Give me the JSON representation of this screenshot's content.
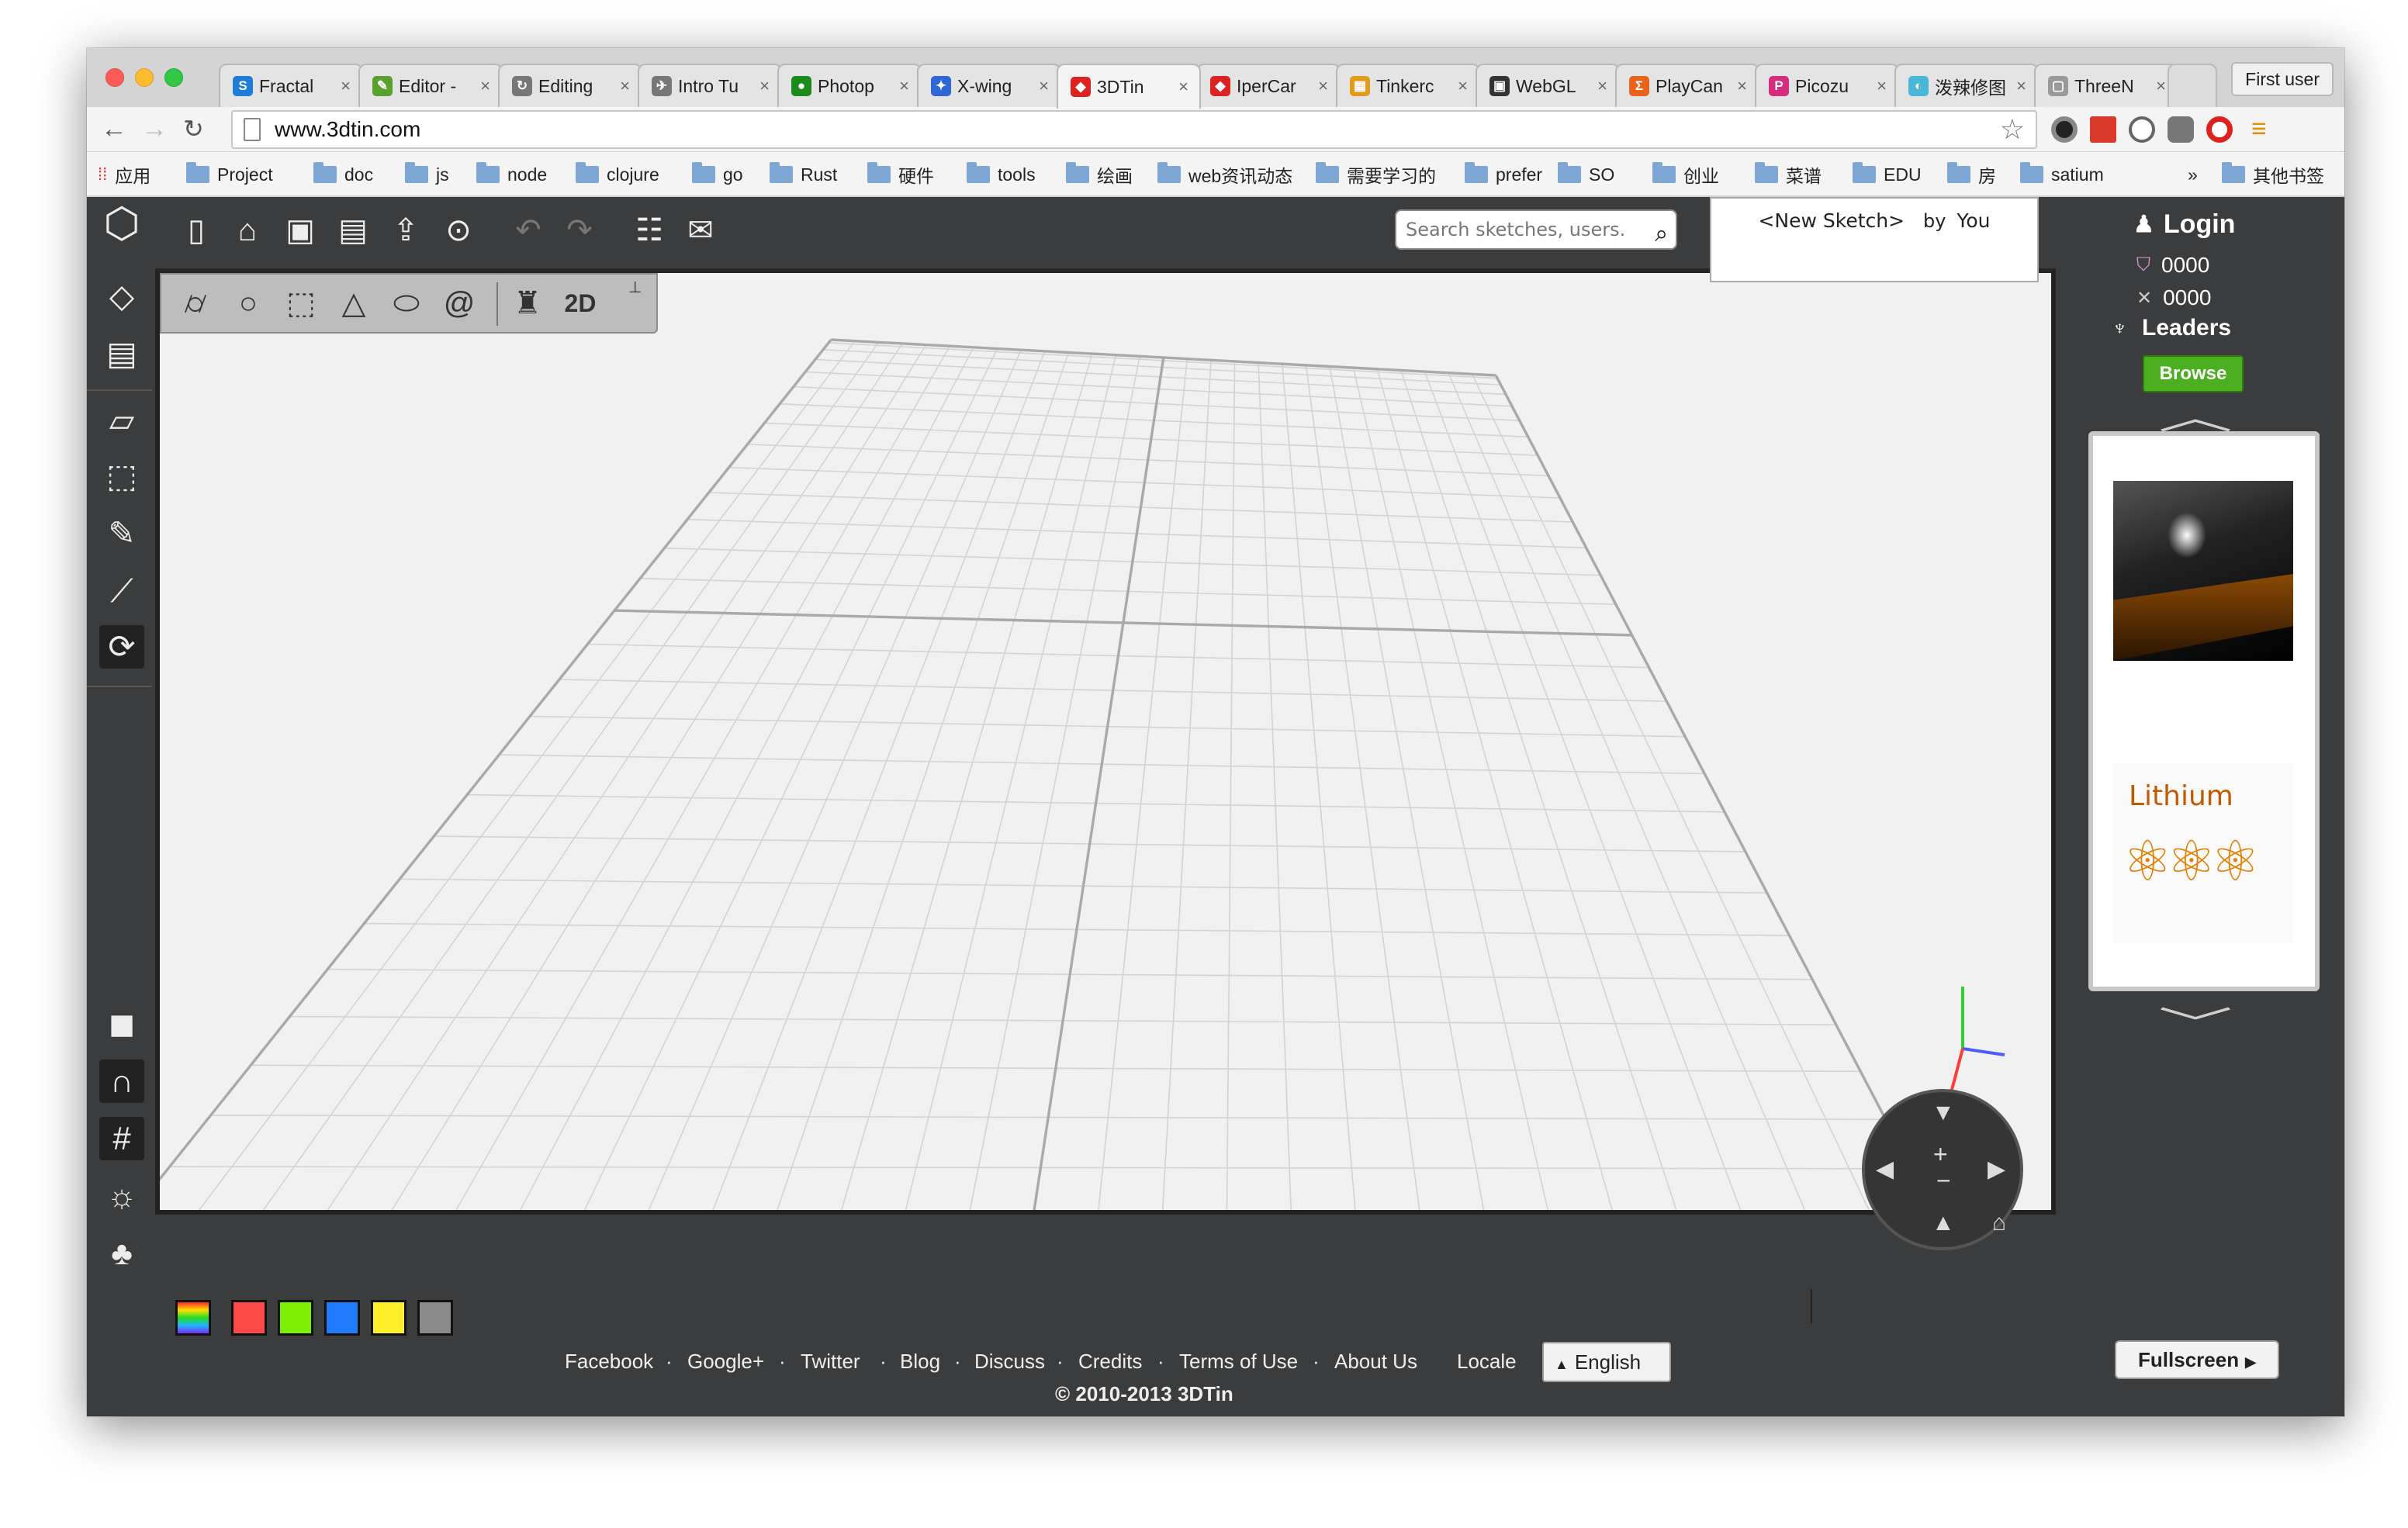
{
  "browser": {
    "tabs": [
      {
        "label": "Fractal",
        "fav": "S",
        "color": "#1e7dd8"
      },
      {
        "label": "Editor -",
        "fav": "✎",
        "color": "#5aa02c"
      },
      {
        "label": "Editing",
        "fav": "↻",
        "color": "#777"
      },
      {
        "label": "Intro Tu",
        "fav": "✈",
        "color": "#777"
      },
      {
        "label": "Photop",
        "fav": "●",
        "color": "#1b8c1b"
      },
      {
        "label": "X-wing",
        "fav": "✦",
        "color": "#3166d6"
      },
      {
        "label": "3DTin",
        "fav": "◆",
        "color": "#d22"
      },
      {
        "label": "IperCar",
        "fav": "◆",
        "color": "#d22"
      },
      {
        "label": "Tinkerc",
        "fav": "▦",
        "color": "#e39b1c"
      },
      {
        "label": "WebGL",
        "fav": "▣",
        "color": "#333"
      },
      {
        "label": "PlayCan",
        "fav": "Σ",
        "color": "#e8641c"
      },
      {
        "label": "Picozu",
        "fav": "P",
        "color": "#d62c7d"
      },
      {
        "label": "泼辣修图",
        "fav": "◐",
        "color": "#4bb7d8"
      },
      {
        "label": "ThreeN",
        "fav": "▢",
        "color": "#999"
      }
    ],
    "first_user": "First user",
    "url": "www.3dtin.com",
    "bookmarks": [
      "应用",
      "Project",
      "doc",
      "js",
      "node",
      "clojure",
      "go",
      "Rust",
      "硬件",
      "tools",
      "绘画",
      "web资讯动态",
      "需要学习的",
      "prefer",
      "SO",
      "创业",
      "菜谱",
      "EDU",
      "房",
      "satium"
    ],
    "more": "»",
    "other_bookmarks": "其他书签"
  },
  "app": {
    "search_placeholder": "Search sketches, users.",
    "sketch_name": "<New Sketch>",
    "by": "by",
    "author": "You",
    "login": "Login",
    "stat1": "0000",
    "stat2": "0000",
    "leaders": "Leaders",
    "browse": "Browse",
    "thumb2_title": "Lithium",
    "mode_2d": "2D",
    "swatches": [
      "#ff4a4a",
      "#7cf000",
      "#1f7cff",
      "#ffef2a",
      "#8a8a8a"
    ],
    "footer_links": [
      "Facebook",
      "Google+",
      "Twitter",
      "Blog",
      "Discuss",
      "Credits",
      "Terms of Use",
      "About Us"
    ],
    "locale_label": "Locale",
    "language": "English",
    "copyright": "© 2010-2013 3DTin",
    "fullscreen": "Fullscreen"
  }
}
